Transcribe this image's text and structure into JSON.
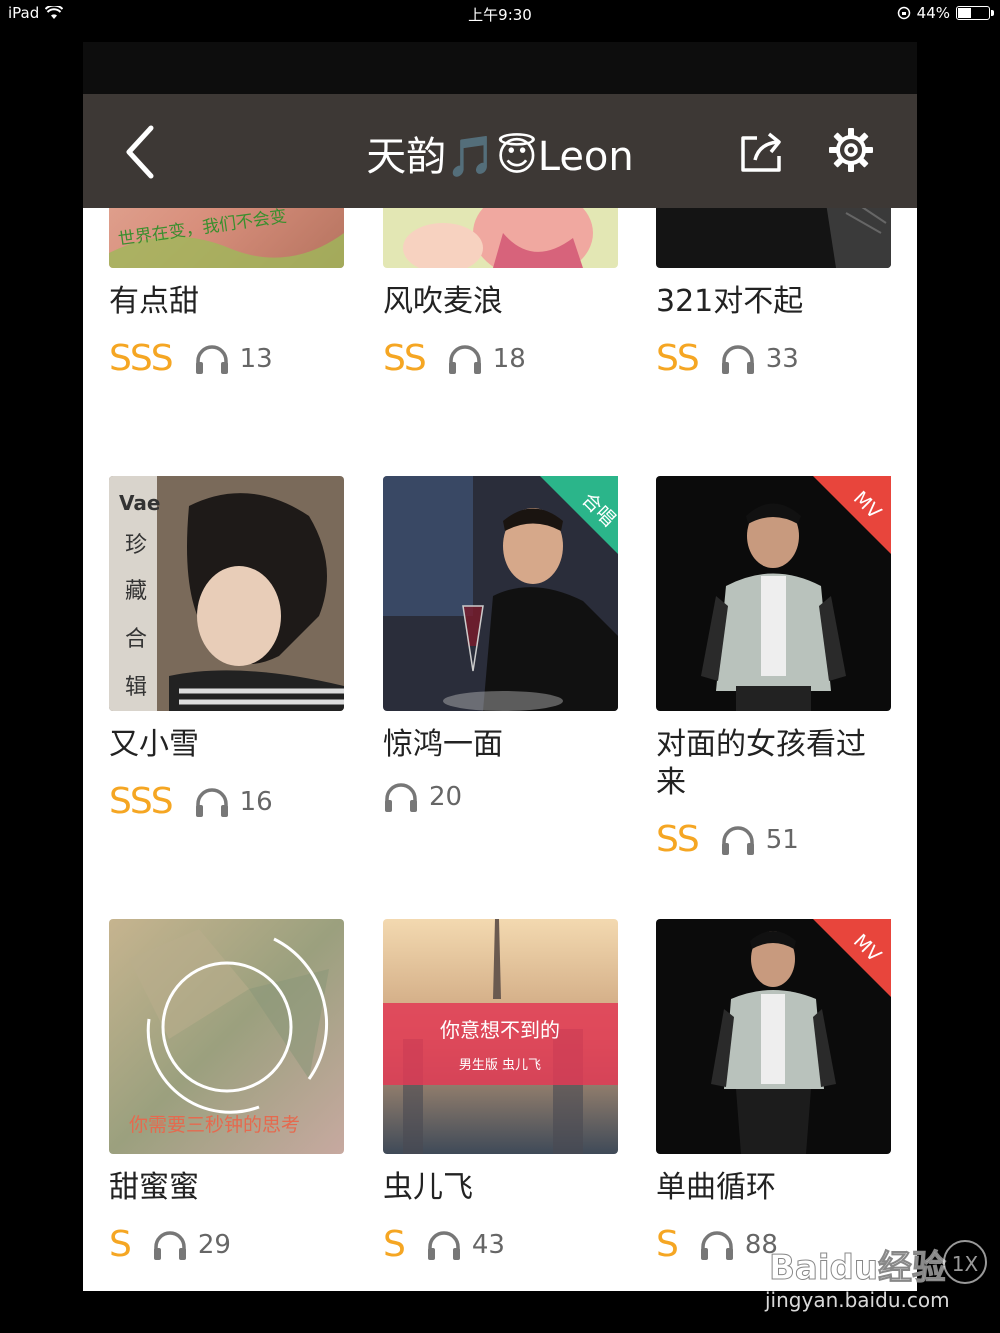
{
  "status_bar": {
    "device": "iPad",
    "time": "上午9:30",
    "battery": "44%",
    "battery_level": 0.44
  },
  "nav": {
    "title": "天韵🎵😇Leon",
    "back_icon": "chevron-left-icon",
    "share_icon": "share-icon",
    "settings_icon": "gear-icon"
  },
  "colors": {
    "nav_bg": "#3d3835",
    "rank": "#f5a623",
    "ribbon_red": "#e8453c",
    "ribbon_green": "#2bb58a"
  },
  "songs": [
    {
      "name": "有点甜",
      "rank": "SSS",
      "plays": "13",
      "cover_text": "世界在变，我们不会变"
    },
    {
      "name": "风吹麦浪",
      "rank": "SS",
      "plays": "18"
    },
    {
      "name": "321对不起",
      "rank": "SS",
      "plays": "33"
    },
    {
      "name": "又小雪",
      "rank": "SSS",
      "plays": "16",
      "cover_text": "Vae 珍藏合辑"
    },
    {
      "name": "惊鸿一面",
      "rank": "",
      "plays": "20",
      "badge": "合唱"
    },
    {
      "name": "对面的女孩看过来",
      "rank": "SS",
      "plays": "51",
      "badge": "MV"
    },
    {
      "name": "甜蜜蜜",
      "rank": "S",
      "plays": "29",
      "cover_text": "你需要三秒钟的思考"
    },
    {
      "name": "虫儿飞",
      "rank": "S",
      "plays": "43",
      "cover_text": "你意想不到的",
      "cover_subtext": "男生版 虫儿飞"
    },
    {
      "name": "单曲循环",
      "rank": "S",
      "plays": "88",
      "badge": "MV"
    }
  ],
  "watermark": {
    "brand": "Baidu经验",
    "url": "jingyan.baidu.com",
    "zoom": "1X"
  }
}
